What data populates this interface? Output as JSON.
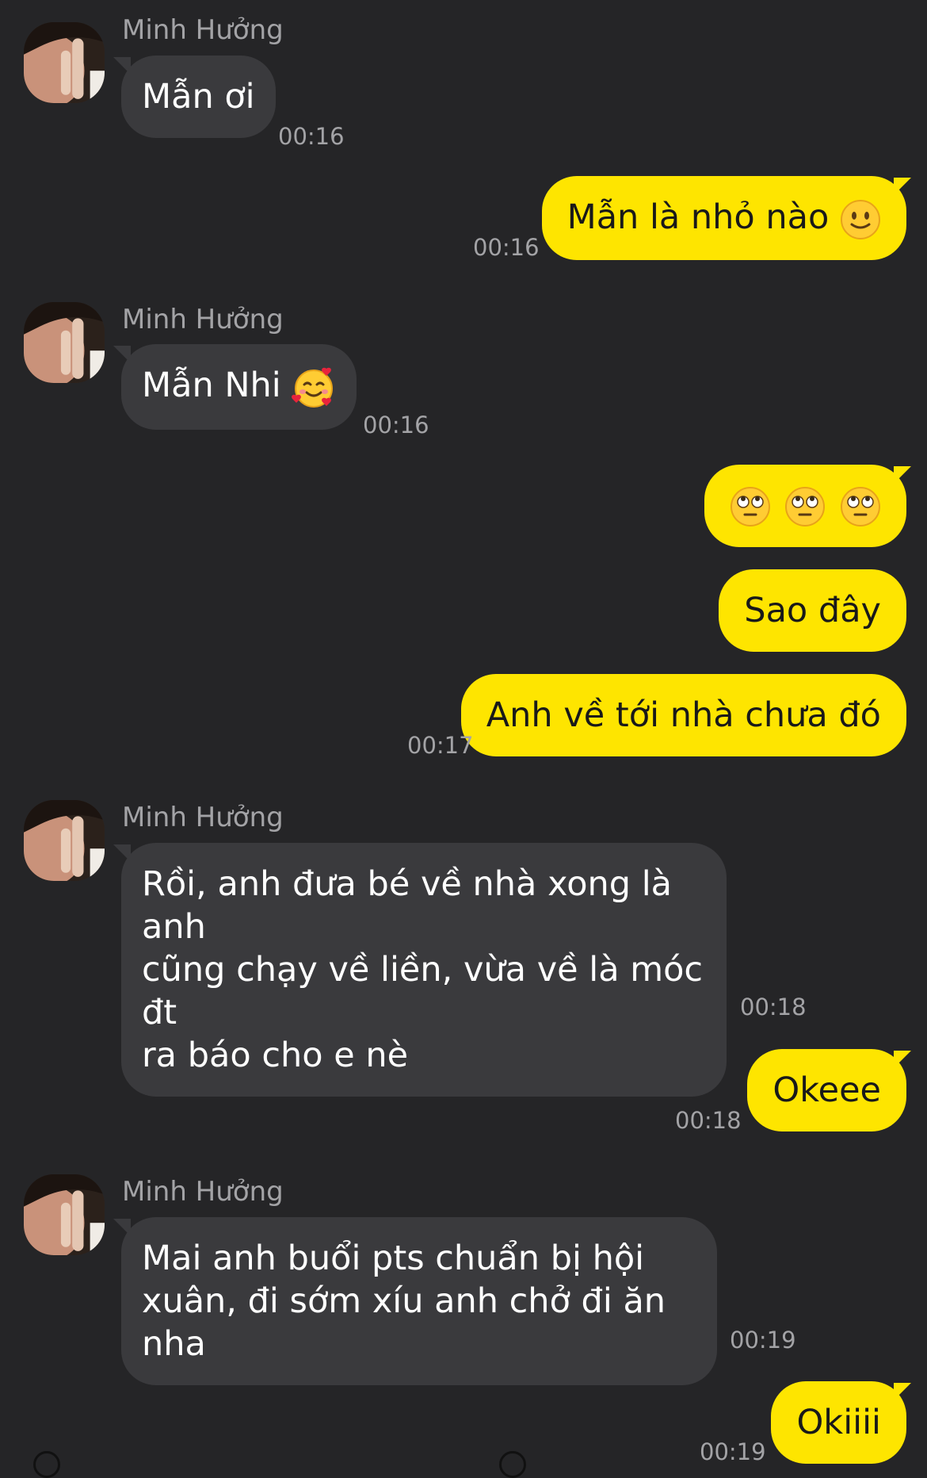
{
  "contact": {
    "name": "Minh Hưởng"
  },
  "messages": [
    {
      "id": "m1",
      "direction": "in",
      "sender": "Minh Hưởng",
      "text": "Mẫn ơi",
      "time": "00:16"
    },
    {
      "id": "m2",
      "direction": "out",
      "text": "Mẫn là nhỏ nào",
      "emoji": "slightly-smiling-face",
      "time": "00:16"
    },
    {
      "id": "m3",
      "direction": "in",
      "sender": "Minh Hưởng",
      "text": "Mẫn Nhi",
      "emoji": "smiling-face-with-hearts",
      "time": "00:16"
    },
    {
      "id": "m4",
      "direction": "out",
      "emojis": [
        "face-with-rolling-eyes",
        "face-with-rolling-eyes",
        "face-with-rolling-eyes"
      ]
    },
    {
      "id": "m5",
      "direction": "out",
      "text": "Sao đây"
    },
    {
      "id": "m6",
      "direction": "out",
      "text": "Anh về tới nhà chưa đó",
      "time": "00:17"
    },
    {
      "id": "m7",
      "direction": "in",
      "sender": "Minh Hưởng",
      "lines": [
        "Rồi, anh đưa bé về nhà xong là anh",
        "cũng chạy về liền, vừa về là móc đt",
        "ra báo cho e nè"
      ],
      "time": "00:18"
    },
    {
      "id": "m8",
      "direction": "out",
      "text": "Okeee",
      "time": "00:18"
    },
    {
      "id": "m9",
      "direction": "in",
      "sender": "Minh Hưởng",
      "lines": [
        "Mai anh buổi pts chuẩn bị hội",
        "xuân, đi sớm xíu anh chở đi ăn nha"
      ],
      "time": "00:19"
    },
    {
      "id": "m10",
      "direction": "out",
      "text": "Okiiii",
      "time": "00:19"
    }
  ],
  "colors": {
    "background": "#252527",
    "incoming_bubble": "#3a3a3d",
    "outgoing_bubble": "#fee500",
    "outgoing_text": "#191919",
    "timestamp": "#a3a3a6"
  }
}
